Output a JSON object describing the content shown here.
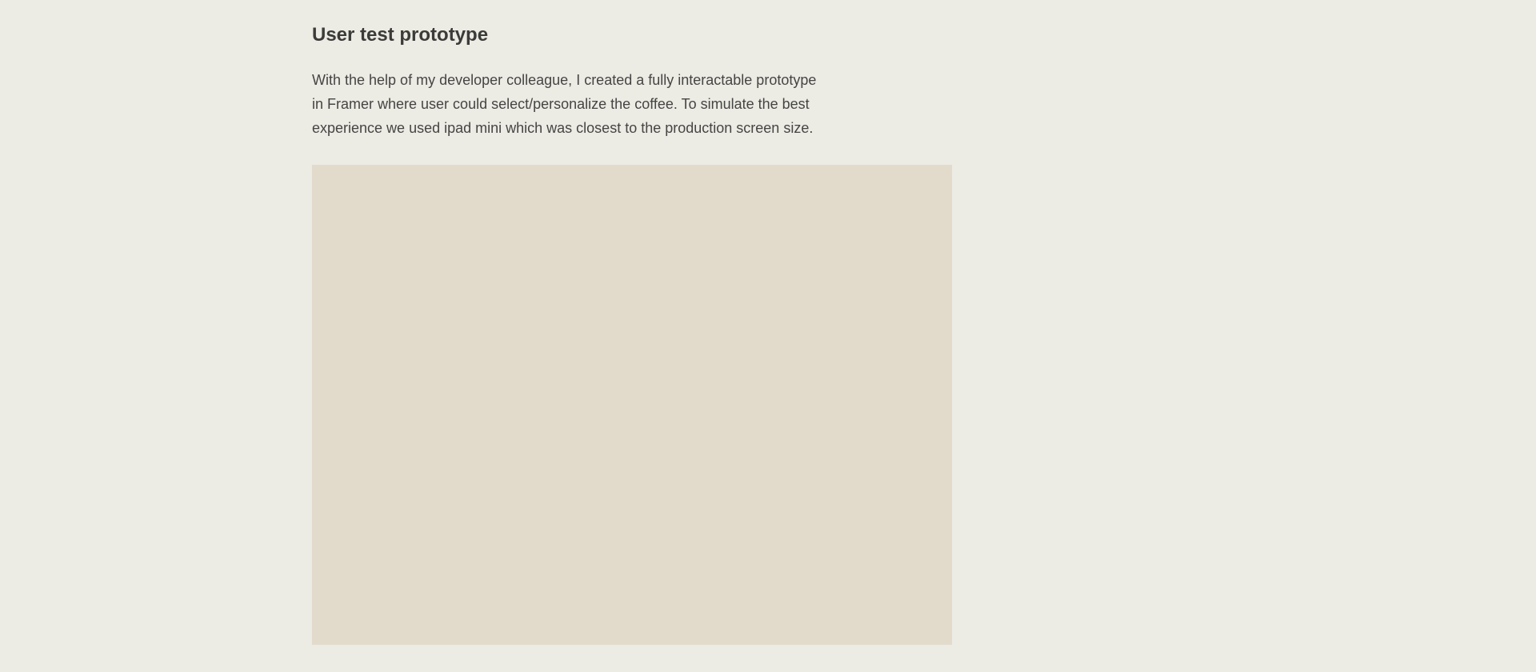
{
  "section": {
    "heading": "User test prototype",
    "paragraph_lines": [
      "With the help of my developer colleague, I created a fully interactable prototype",
      "in Framer where user could select/personalize the coffee. To simulate the best",
      "experience we used ipad mini which was closest to the production screen size."
    ]
  },
  "colors": {
    "page_background": "#ecebe4",
    "text": "#3f3f3d",
    "media_placeholder": "#e2dbcc"
  }
}
